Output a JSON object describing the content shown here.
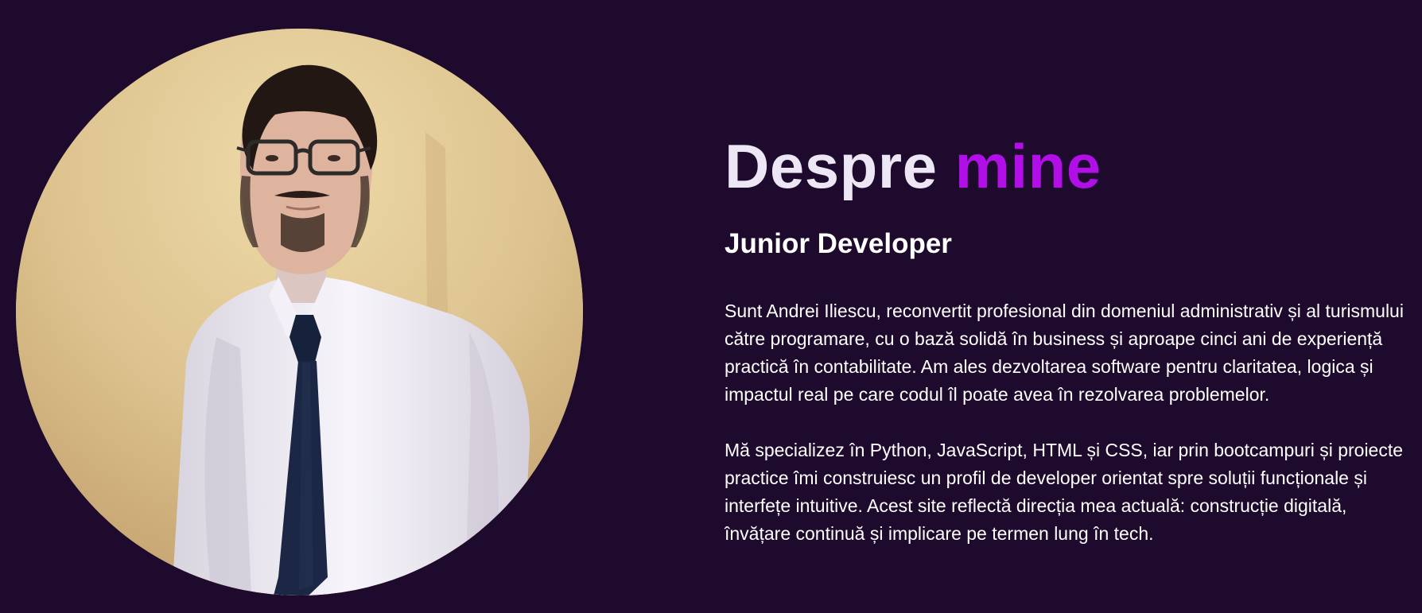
{
  "about": {
    "title_prefix": "Despre",
    "title_accent": "mine",
    "subtitle": "Junior Developer",
    "paragraphs": [
      "Sunt Andrei Iliescu, reconvertit profesional din domeniul administrativ și al turismului către programare, cu o bază solidă în business și aproape cinci ani de experiență practică în contabilitate. Am ales dezvoltarea software pentru claritatea, logica și impactul real pe care codul îl poate avea în rezolvarea problemelor.",
      "Mă specializez în Python, JavaScript, HTML și CSS, iar prin bootcampuri și proiecte practice îmi construiesc un profil de developer orientat spre soluții funcționale și interfețe intuitive. Acest site reflectă direcția mea actuală: construcție digitală, învățare continuă și implicare pe termen lung în tech."
    ]
  },
  "colors": {
    "background": "#1e0a2c",
    "accent": "#b10ee8",
    "title": "#ede6f4",
    "text": "#ffffff"
  }
}
